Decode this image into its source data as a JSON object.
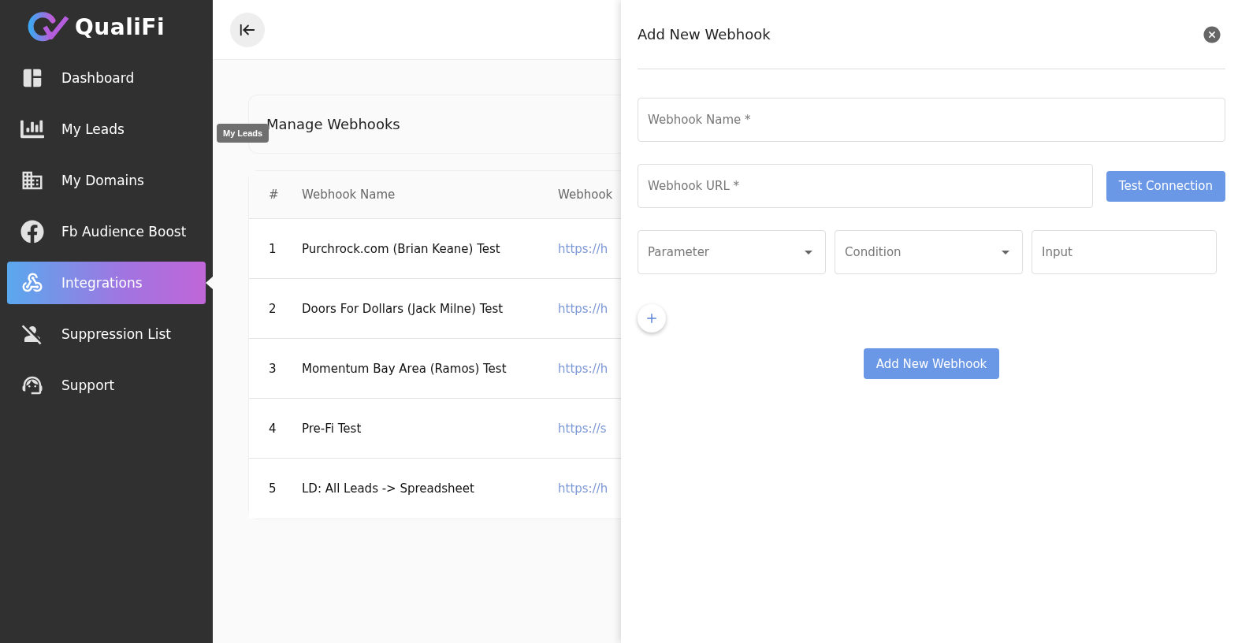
{
  "brand": {
    "name": "QualiFi"
  },
  "sidebar": {
    "items": [
      {
        "label": "Dashboard",
        "selected": false
      },
      {
        "label": "My Leads",
        "selected": false
      },
      {
        "label": "My Domains",
        "selected": false
      },
      {
        "label": "Fb Audience Boost",
        "selected": false
      },
      {
        "label": "Integrations",
        "selected": true
      },
      {
        "label": "Suppression List",
        "selected": false
      },
      {
        "label": "Support",
        "selected": false
      }
    ]
  },
  "tooltip": "My Leads",
  "page": {
    "title": "Manage Webhooks"
  },
  "table": {
    "columns": [
      "#",
      "Webhook Name",
      "Webhook"
    ],
    "rows": [
      {
        "index": "1",
        "name": "Purchrock.com (Brian Keane) Test",
        "url": "https://h"
      },
      {
        "index": "2",
        "name": "Doors For Dollars (Jack Milne) Test",
        "url": "https://h"
      },
      {
        "index": "3",
        "name": "Momentum Bay Area (Ramos) Test",
        "url": "https://h"
      },
      {
        "index": "4",
        "name": "Pre-Fi Test",
        "url": "https://s"
      },
      {
        "index": "5",
        "name": "LD: All Leads -> Spreadsheet",
        "url": "https://h"
      }
    ]
  },
  "drawer": {
    "title": "Add New Webhook",
    "name_field": {
      "placeholder": "Webhook Name *"
    },
    "url_field": {
      "placeholder": "Webhook URL *"
    },
    "test_button": "Test Connection",
    "rule_fields": [
      {
        "kind": "select",
        "placeholder": "Parameter"
      },
      {
        "kind": "select",
        "placeholder": "Condition"
      },
      {
        "kind": "text",
        "placeholder": "Input"
      }
    ],
    "submit_button": "Add New Webhook"
  }
}
